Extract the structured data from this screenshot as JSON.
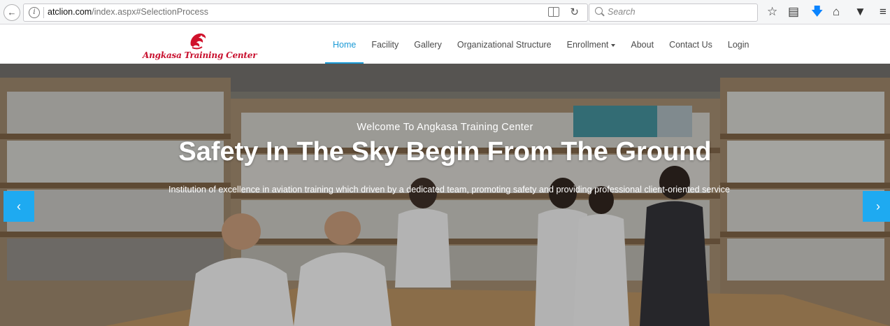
{
  "browser": {
    "url_domain": "atclion.com",
    "url_path": "/index.aspx#SelectionProcess",
    "search_placeholder": "Search",
    "back_icon": "back-arrow-icon",
    "toolbar_icons": [
      "bookmark-star-icon",
      "reading-list-icon",
      "download-icon",
      "home-icon",
      "pocket-icon",
      "menu-icon"
    ]
  },
  "site": {
    "logo_text": "Angkasa Training Center",
    "brand_color": "#c8102e",
    "accent_color": "#1a9ad6",
    "nav": [
      {
        "label": "Home",
        "active": true
      },
      {
        "label": "Facility"
      },
      {
        "label": "Gallery"
      },
      {
        "label": "Organizational Structure"
      },
      {
        "label": "Enrollment",
        "dropdown": true
      },
      {
        "label": "About"
      },
      {
        "label": "Contact Us"
      },
      {
        "label": "Login"
      }
    ]
  },
  "hero": {
    "welcome": "Welcome To Angkasa Training Center",
    "title": "Safety In The Sky Begin From The Ground",
    "description": "Institution of excellence in aviation training which driven by a dedicated team, promoting safety and providing professional client-oriented service",
    "prev_label": "‹",
    "next_label": "›"
  }
}
